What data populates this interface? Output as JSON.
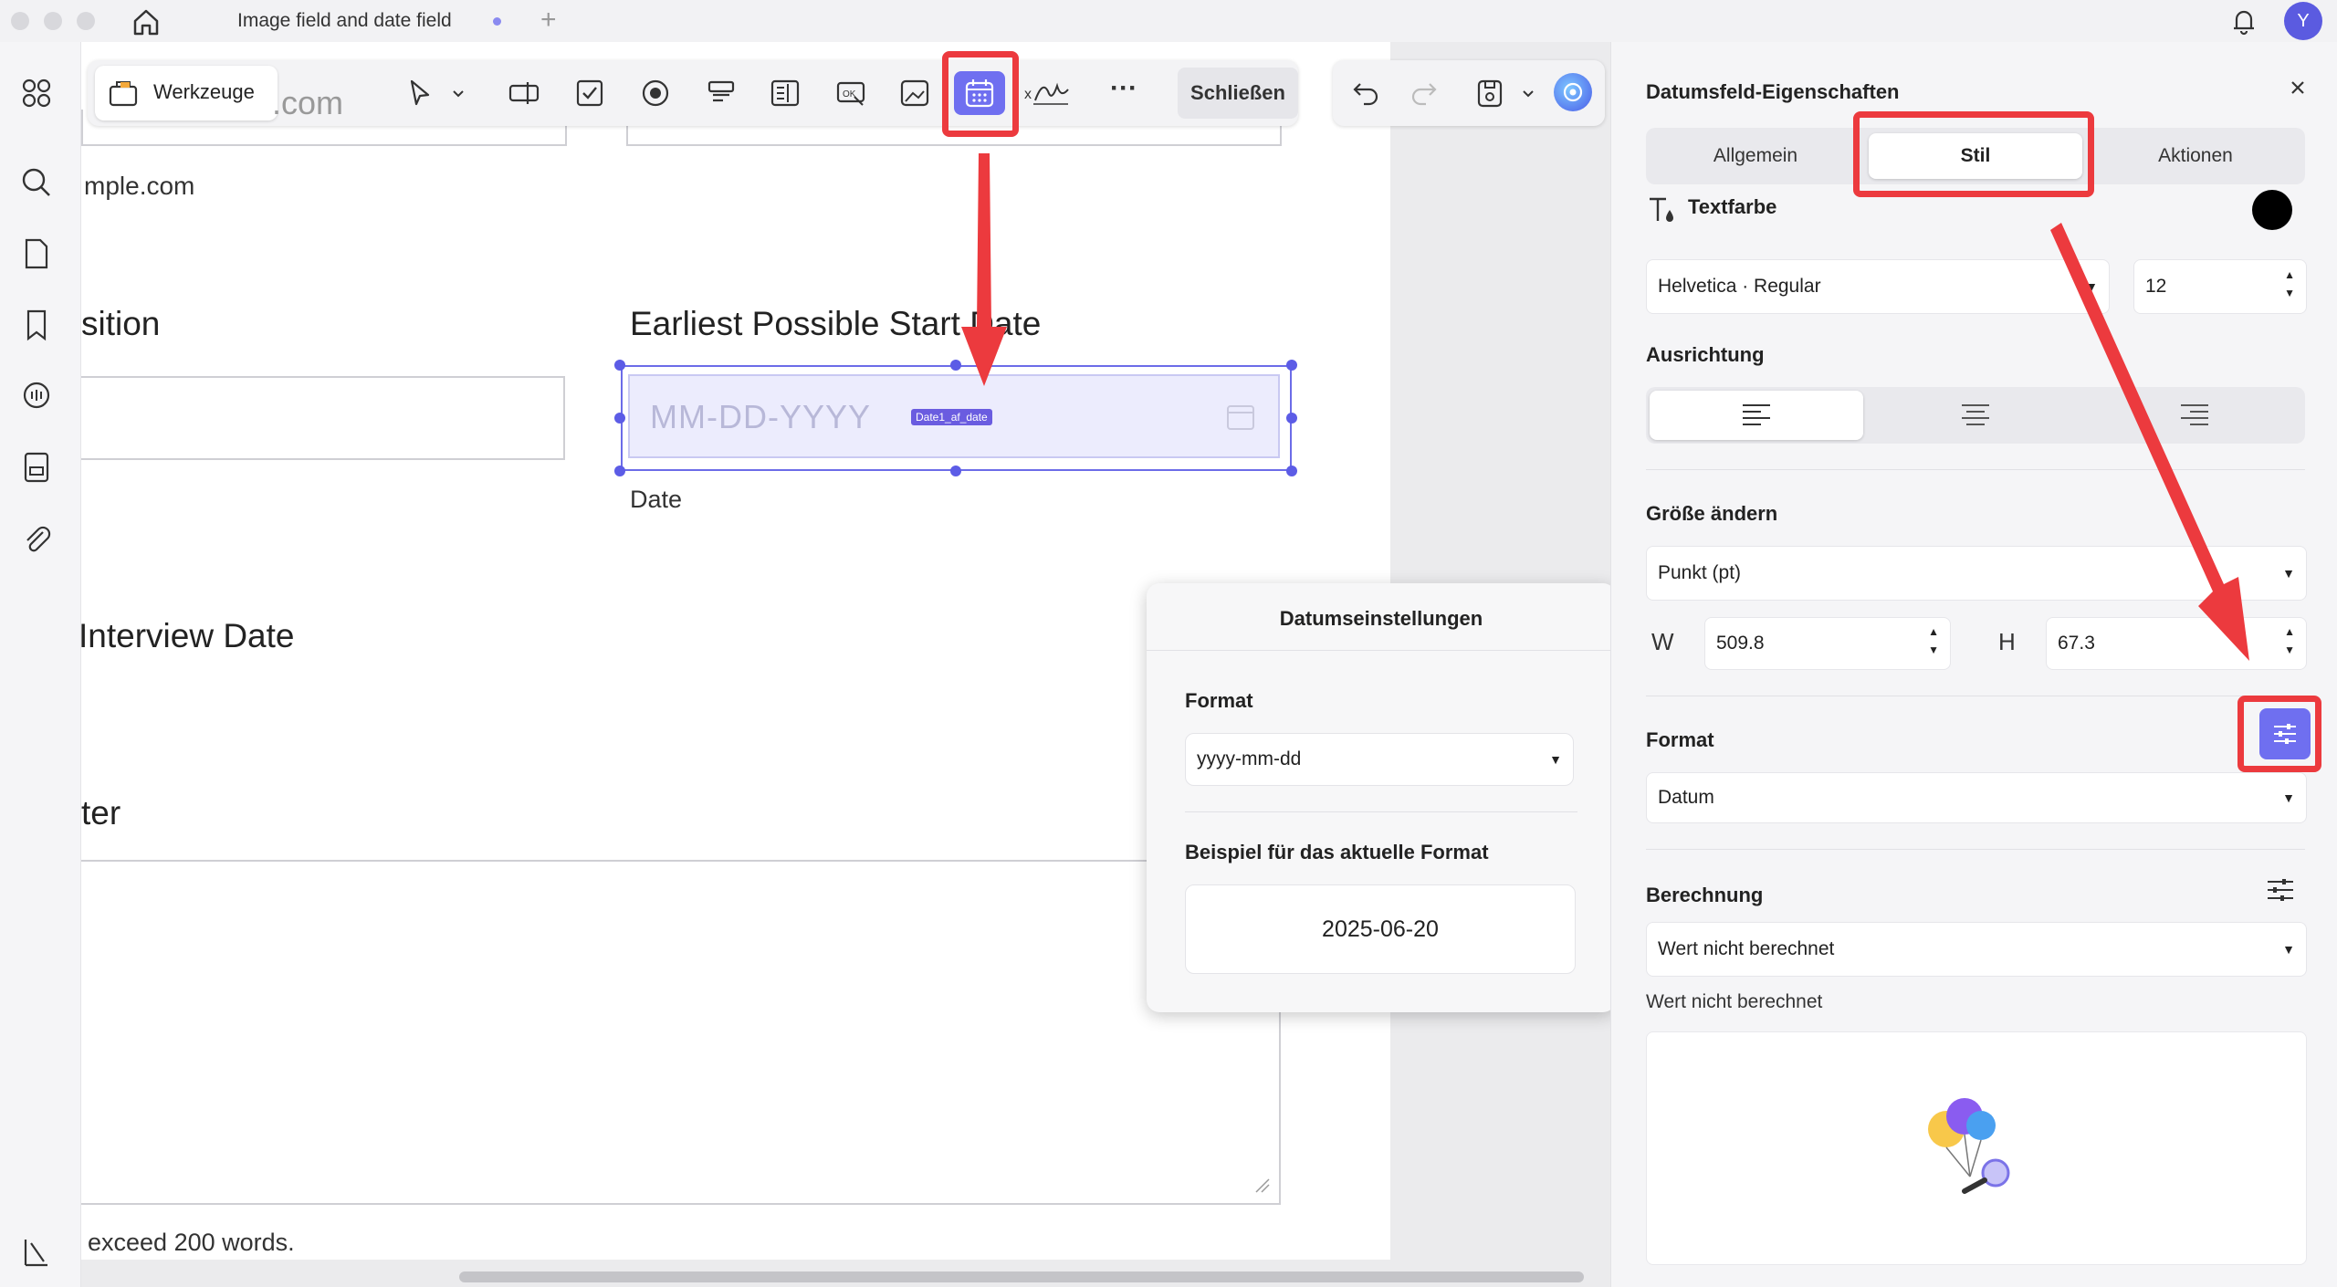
{
  "window": {
    "tab_title": "Image field and date field",
    "new_tab": "+",
    "avatar_initial": "Y"
  },
  "document": {
    "email_fragment": ".com",
    "email_example": "mple.com",
    "position_label": "sition",
    "start_date_label": "Earliest Possible Start Date",
    "date_placeholder": "MM-DD-YYYY",
    "field_tag": "Date1_af_date",
    "date_caption": "Date",
    "interview_label": "Interview Date",
    "cover_label": "ter",
    "words_note": "exceed 200 words."
  },
  "toolbar": {
    "werkzeuge": "Werkzeuge",
    "close": "Schließen",
    "more": "···"
  },
  "popover": {
    "title": "Datumseinstellungen",
    "format_label": "Format",
    "format_value": "yyyy-mm-dd",
    "example_label": "Beispiel für das aktuelle Format",
    "example_value": "2025-06-20"
  },
  "panel": {
    "title": "Datumsfeld-Eigenschaften",
    "tabs": [
      "Allgemein",
      "Stil",
      "Aktionen"
    ],
    "active_tab": "Stil",
    "text_color_label": "Textfarbe",
    "text_color": "#000000",
    "font_value": "Helvetica · Regular",
    "font_size": "12",
    "alignment_label": "Ausrichtung",
    "resize_label": "Größe ändern",
    "unit_value": "Punkt (pt)",
    "w_label": "W",
    "w_value": "509.8",
    "h_label": "H",
    "h_value": "67.3",
    "format_label": "Format",
    "format_value": "Datum",
    "calc_label": "Berechnung",
    "calc_value": "Wert nicht berechnet",
    "calc_text": "Wert nicht berechnet"
  },
  "colors": {
    "accent": "#5c5ce6",
    "highlight": "#ec3a3e"
  }
}
